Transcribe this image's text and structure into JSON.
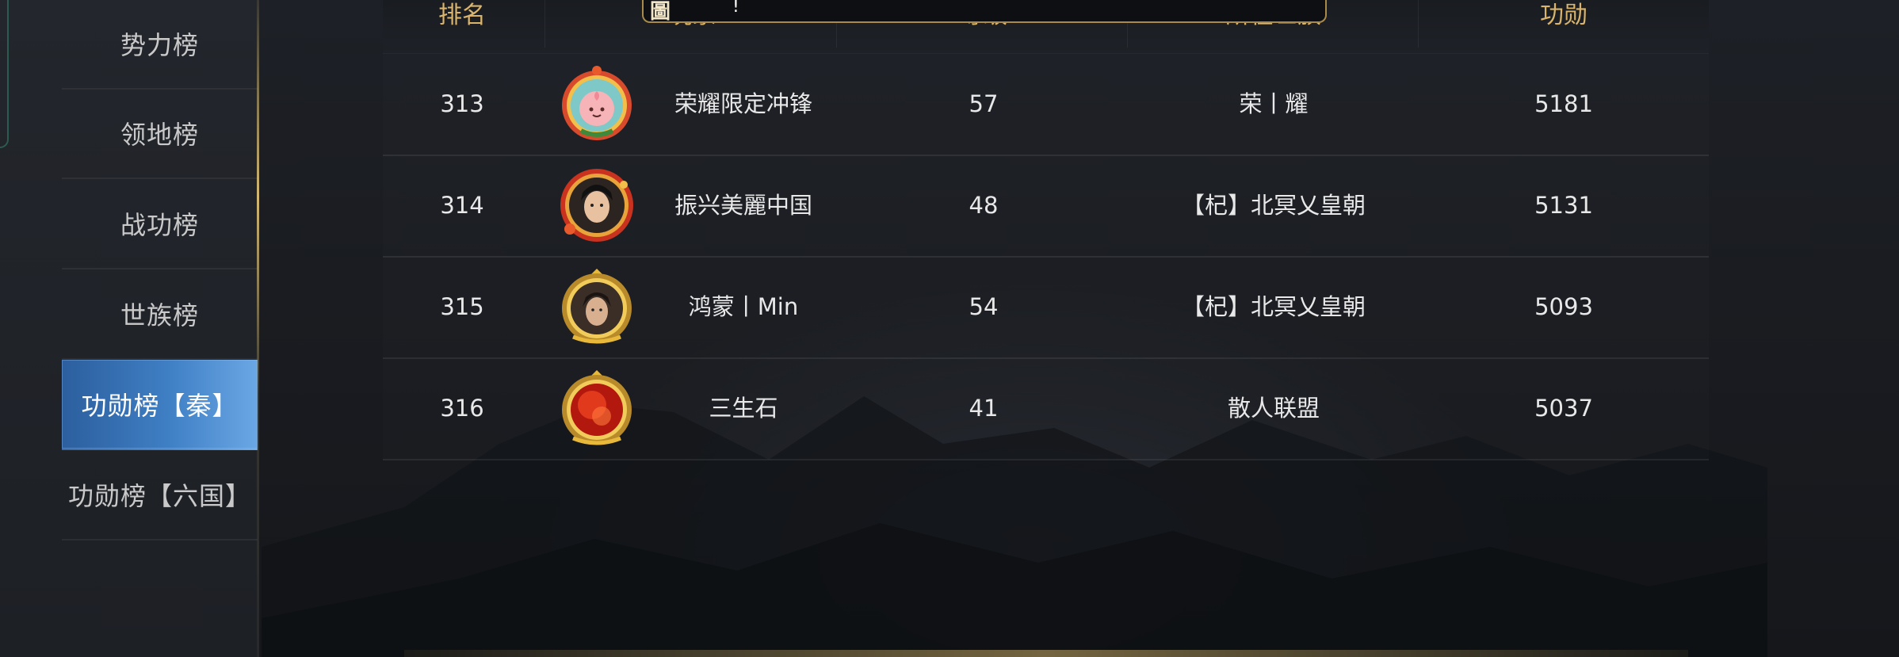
{
  "sidebar": {
    "items": [
      {
        "label": "势力榜",
        "active": false
      },
      {
        "label": "领地榜",
        "active": false
      },
      {
        "label": "战功榜",
        "active": false
      },
      {
        "label": "世族榜",
        "active": false
      },
      {
        "label": "功勋榜【秦】",
        "active": true
      },
      {
        "label": "功勋榜【六国】",
        "active": false
      }
    ]
  },
  "table": {
    "headers": {
      "rank": "排名",
      "player": "玩家",
      "level": "等级",
      "clan": "所在世族",
      "merit": "功勋"
    },
    "rows": [
      {
        "rank": "313",
        "name": "荣耀限定冲锋",
        "level": "57",
        "clan": "荣丨耀",
        "merit": "5181",
        "avatar": "peach-mascot-avatar"
      },
      {
        "rank": "314",
        "name": "振兴美麗中国",
        "level": "48",
        "clan": "【杞】北冥乂皇朝",
        "merit": "5131",
        "avatar": "female-warrior-avatar"
      },
      {
        "rank": "315",
        "name": "鸿蒙丨Min",
        "level": "54",
        "clan": "【杞】北冥乂皇朝",
        "merit": "5093",
        "avatar": "male-swordsman-avatar"
      },
      {
        "rank": "316",
        "name": "三生石",
        "level": "41",
        "clan": "散人联盟",
        "merit": "5037",
        "avatar": "red-orb-avatar"
      }
    ]
  },
  "tooltip": {
    "icon": "tooltip-icon",
    "text": "!"
  },
  "colors": {
    "header_gold": "#d9b46a",
    "active_tab": "#3f7fc4",
    "text": "#e8e8e8"
  }
}
